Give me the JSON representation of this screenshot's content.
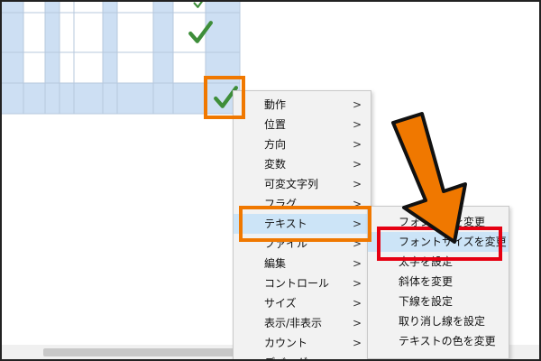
{
  "colors": {
    "orange": "#f07800",
    "red": "#e60012",
    "check": "#3e8e3a",
    "grid_blue": "#cddff3",
    "menu_bg": "#f2f2f2",
    "hover": "#cce4f7"
  },
  "icons": {
    "check": "check-mark-icon",
    "arrow": "arrow-down-icon",
    "submenu": "chevron-right-icon"
  },
  "menu": {
    "items": [
      {
        "label": "動作",
        "arrow": ">"
      },
      {
        "label": "位置",
        "arrow": ">"
      },
      {
        "label": "方向",
        "arrow": ">"
      },
      {
        "label": "変数",
        "arrow": ">"
      },
      {
        "label": "可変文字列",
        "arrow": ">"
      },
      {
        "label": "フラグ",
        "arrow": ">"
      },
      {
        "label": "テキスト",
        "arrow": ">"
      },
      {
        "label": "ファイル",
        "arrow": ">"
      },
      {
        "label": "編集",
        "arrow": ">"
      },
      {
        "label": "コントロール",
        "arrow": ">"
      },
      {
        "label": "サイズ",
        "arrow": ">"
      },
      {
        "label": "表示/非表示",
        "arrow": ">"
      },
      {
        "label": "カウント",
        "arrow": ">"
      },
      {
        "label": "デバッグ",
        "arrow": ">"
      }
    ]
  },
  "submenu": {
    "items": [
      {
        "label": "フォント名を変更"
      },
      {
        "label": "フォントサイズを変更"
      },
      {
        "label": "太字を設定"
      },
      {
        "label": "斜体を変更"
      },
      {
        "label": "下線を設定"
      },
      {
        "label": "取り消し線を設定"
      },
      {
        "label": "テキストの色を変更"
      }
    ]
  }
}
